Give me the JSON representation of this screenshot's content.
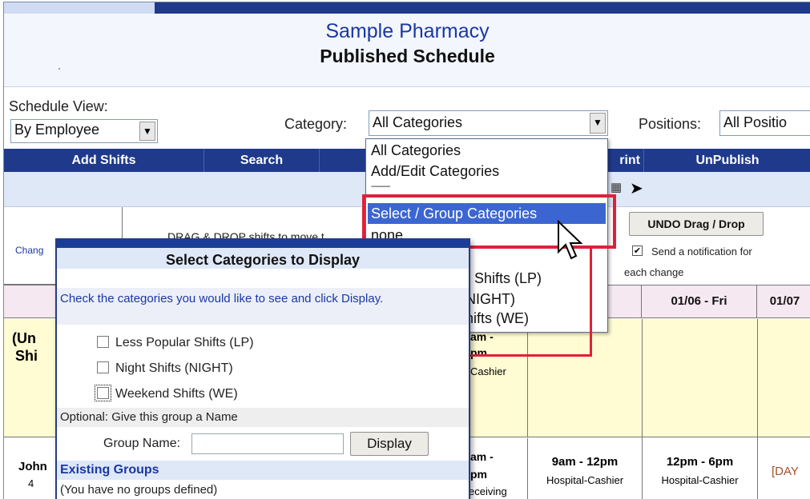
{
  "header": {
    "pharmacy_name": "Sample Pharmacy",
    "title": "Published Schedule"
  },
  "controls": {
    "schedule_view_label": "Schedule View:",
    "schedule_view_value": "By Employee",
    "category_label": "Category:",
    "category_value": "All Categories",
    "positions_label": "Positions:",
    "positions_value": "All Positio"
  },
  "navbar": {
    "add_shifts": "Add Shifts",
    "search": "Search",
    "print": "rint",
    "unpublish": "UnPublish"
  },
  "toolbar": {
    "change_link": "Chang",
    "drag_hint": "DRAG & DROP shifts to move t",
    "undo_button": "UNDO Drag / Drop",
    "notify_label": "Send a notification for",
    "notify_label2": "each change"
  },
  "category_menu": {
    "items": [
      "All Categories",
      "Add/Edit Categories",
      "----------",
      "Select / Group Categories",
      "none",
      "r Shifts (LP)",
      "NIGHT)",
      "hifts (WE)"
    ],
    "selected_index": 3
  },
  "grid": {
    "col_headers": [
      "u",
      "01/06 - Fri",
      "01/07"
    ],
    "row1_label": [
      "(Un",
      "Shi"
    ],
    "row1_cells": [
      "am -",
      "pm",
      "Cashier"
    ],
    "row2_label": [
      "John",
      "4"
    ],
    "row2_col0": [
      "am -",
      "pm",
      "eceiving"
    ],
    "row2_col1": [
      "9am - 12pm",
      "Hospital-Cashier"
    ],
    "row2_col2": [
      "12pm - 6pm",
      "Hospital-Cashier"
    ],
    "row2_col3": "[DAY"
  },
  "dialog": {
    "title": "Select Categories to Display",
    "instructions": "Check the categories you would like to see and click Display.",
    "options": [
      "Less Popular Shifts (LP)",
      "Night Shifts (NIGHT)",
      "Weekend Shifts (WE)"
    ],
    "optional_label": "Optional: Give this group a Name",
    "group_name_label": "Group Name:",
    "group_name_value": "",
    "display_button": "Display",
    "existing_groups_label": "Existing Groups",
    "no_groups_text": "(You have no groups defined)"
  },
  "colors": {
    "nav_blue": "#1f3a8a",
    "highlight_red": "#e0203a",
    "selection_blue": "#3b66d2",
    "row_yellow": "#fffbd2"
  }
}
